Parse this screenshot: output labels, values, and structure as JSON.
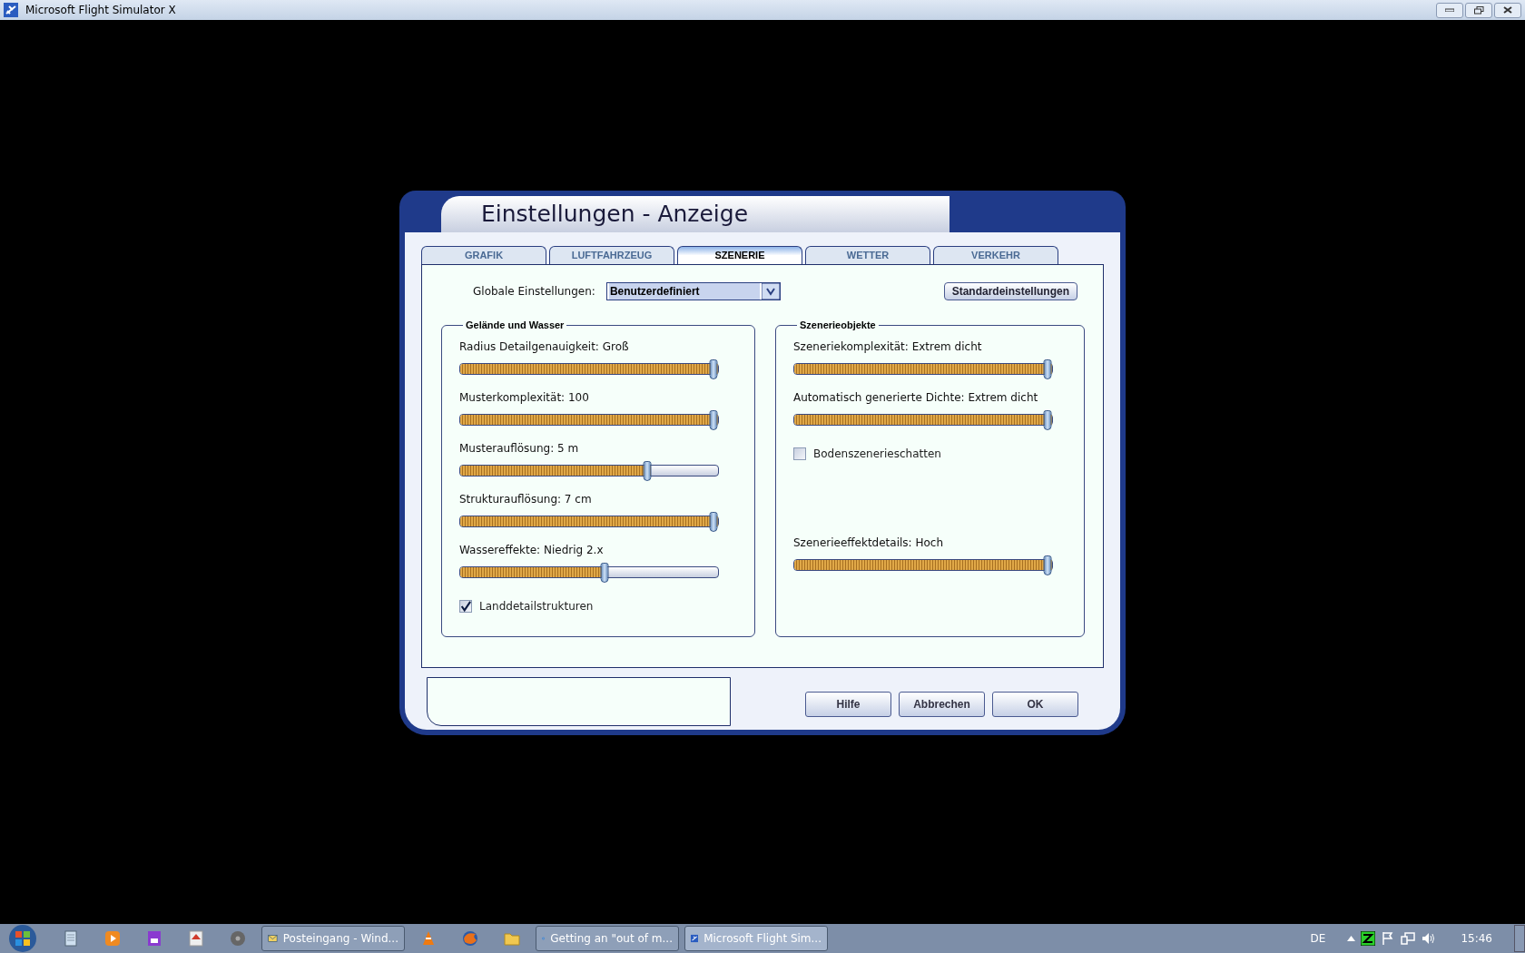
{
  "window": {
    "title": "Microsoft Flight Simulator X"
  },
  "dialog": {
    "title": "Einstellungen - Anzeige",
    "tabs": [
      {
        "label": "GRAFIK",
        "selected": false
      },
      {
        "label": "LUFTFAHRZEUG",
        "selected": false
      },
      {
        "label": "SZENERIE",
        "selected": true
      },
      {
        "label": "WETTER",
        "selected": false
      },
      {
        "label": "VERKEHR",
        "selected": false
      }
    ],
    "global_settings": {
      "label": "Globale Einstellungen:",
      "value": "Benutzerdefiniert"
    },
    "defaults_button": "Standardeinstellungen",
    "groups": [
      {
        "title": "Gelände und Wasser",
        "items": [
          {
            "kind": "slider",
            "label": "Radius Detailgenauigkeit: Groß",
            "level": 1
          },
          {
            "kind": "slider",
            "label": "Musterkomplexität: 100",
            "level": 1
          },
          {
            "kind": "slider",
            "label": "Musterauflösung: 5 m",
            "level": 0.74
          },
          {
            "kind": "slider",
            "label": "Strukturauflösung: 7 cm",
            "level": 1
          },
          {
            "kind": "slider",
            "label": "Wassereffekte: Niedrig 2.x",
            "level": 0.57
          },
          {
            "kind": "checkbox",
            "label": "Landdetailstrukturen",
            "checked": true
          }
        ]
      },
      {
        "title": "Szenerieobjekte",
        "items": [
          {
            "kind": "slider",
            "label": "Szeneriekomplexität: Extrem dicht",
            "level": 1
          },
          {
            "kind": "slider",
            "label": "Automatisch generierte Dichte: Extrem dicht",
            "level": 1
          },
          {
            "kind": "checkbox",
            "label": "Bodenszenerieschatten",
            "checked": false
          },
          {
            "kind": "slider",
            "label": "Szenerieeffektdetails: Hoch",
            "level": 1
          }
        ]
      }
    ],
    "buttons": [
      "Hilfe",
      "Abbrechen",
      "OK"
    ]
  },
  "taskbar": {
    "buttons": [
      {
        "kind": "icon"
      },
      {
        "kind": "icon"
      },
      {
        "kind": "icon"
      },
      {
        "kind": "icon"
      },
      {
        "kind": "icon"
      },
      {
        "kind": "window",
        "label": "Posteingang - Wind...",
        "selected": false
      },
      {
        "kind": "icon"
      },
      {
        "kind": "icon"
      },
      {
        "kind": "icon"
      },
      {
        "kind": "window",
        "label": "Getting an \"out of m...",
        "selected": false
      },
      {
        "kind": "window",
        "label": "Microsoft Flight Sim...",
        "selected": true
      }
    ],
    "language": "DE",
    "time": "15:46"
  }
}
